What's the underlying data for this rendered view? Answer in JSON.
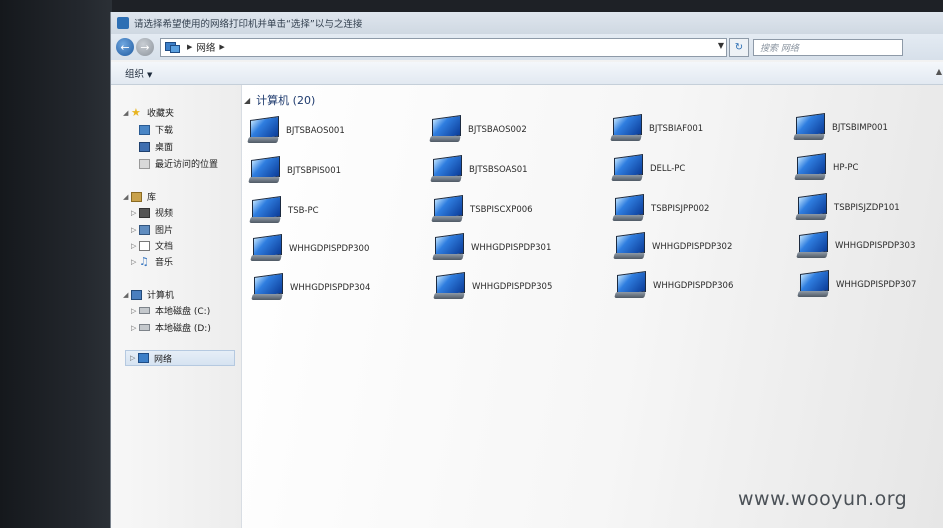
{
  "window": {
    "title": "请选择希望使用的网络打印机并单击“选择”以与之连接"
  },
  "address_bar": {
    "path_segment": "网络",
    "search_placeholder": "搜索 网络"
  },
  "toolbar": {
    "organize_label": "组织"
  },
  "nav_pane": {
    "favorites": {
      "label": "收藏夹",
      "items": [
        "下载",
        "桌面",
        "最近访问的位置"
      ]
    },
    "libraries": {
      "label": "库",
      "items": [
        "视频",
        "图片",
        "文档",
        "音乐"
      ]
    },
    "computer": {
      "label": "计算机",
      "items": [
        "本地磁盘 (C:)",
        "本地磁盘 (D:)"
      ]
    },
    "network": {
      "label": "网络"
    }
  },
  "content": {
    "group_title": "计算机 (20)",
    "computers": [
      "BJTSBAOS001",
      "BJTSBAOS002",
      "BJTSBIAF001",
      "BJTSBIMP001",
      "BJTSBPIS001",
      "BJTSBSOAS01",
      "DELL-PC",
      "HP-PC",
      "TSB-PC",
      "TSBPISCXP006",
      "TSBPISJPP002",
      "TSBPISJZDP101",
      "WHHGDPISPDP300",
      "WHHGDPISPDP301",
      "WHHGDPISPDP302",
      "WHHGDPISPDP303",
      "WHHGDPISPDP304",
      "WHHGDPISPDP305",
      "WHHGDPISPDP306",
      "WHHGDPISPDP307"
    ]
  },
  "watermark": "www.wooyun.org",
  "icons": {
    "back": "back-arrow-icon",
    "forward": "forward-arrow-icon",
    "refresh": "refresh-icon",
    "computer": "computer-icon",
    "network": "network-icon"
  }
}
